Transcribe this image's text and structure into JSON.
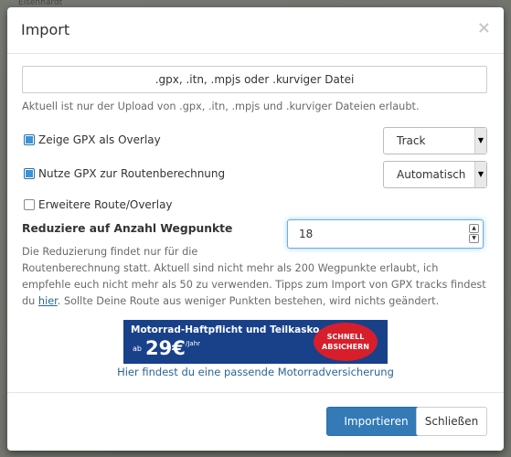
{
  "background": {
    "map_labels": [
      "Eisenhardt"
    ]
  },
  "modal": {
    "title": "Import",
    "close_symbol": "×",
    "file_input": {
      "label": ".gpx, .itn, .mpjs oder .kurviger Datei"
    },
    "upload_help": "Aktuell ist nur der Upload von .gpx, .itn, .mpjs und .kurviger Dateien erlaubt.",
    "overlay": {
      "label": "Zeige GPX als Overlay",
      "checked": true,
      "select_value": "Track"
    },
    "routing": {
      "label": "Nutze GPX zur Routenberechnung",
      "checked": true,
      "select_value": "Automatisch"
    },
    "extended": {
      "label": "Erweitere Route/Overlay",
      "checked": false
    },
    "reduce": {
      "label": "Reduziere auf Anzahl Wegpunkte",
      "value": "18"
    },
    "reduce_help": {
      "line1": "Die Reduzierung findet nur für die",
      "line2": "Routenberechnung statt. Aktuell sind nicht mehr als 200 Wegpunkte erlaubt, ich",
      "line3": "empfehle euch nicht mehr als 50 zu verwenden. Tipps zum Import von GPX tracks findest",
      "line4_prefix": "du ",
      "link": "hier",
      "line4_suffix": ". Sollte Deine Route aus weniger Punkten bestehen, wird nichts geändert."
    },
    "banner": {
      "title": "Motorrad-Haftpflicht und Teilkasko",
      "ab": "ab",
      "price": "29€",
      "per": "/Jahr",
      "badge_line1": "SCHNELL",
      "badge_line2": "ABSICHERN",
      "link": "Hier findest du eine passende Motorradversicherung"
    },
    "buttons": {
      "import": "Importieren",
      "close": "Schließen"
    }
  }
}
